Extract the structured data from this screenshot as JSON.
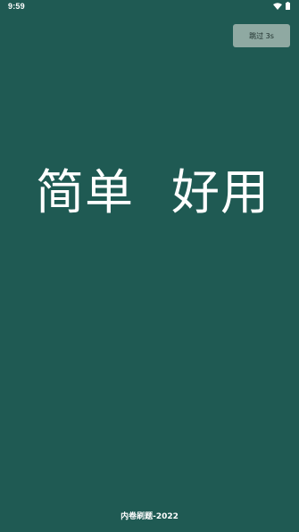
{
  "status_bar": {
    "time": "9:59",
    "wifi_icon": "wifi-icon",
    "battery_icon": "battery-icon"
  },
  "skip_button": {
    "label": "跳过 3s"
  },
  "slogan": {
    "left": "简单",
    "right": "好用"
  },
  "footer": {
    "text": "内卷刷题-2022"
  },
  "colors": {
    "background": "#1f5a53",
    "skip_button_bg": "#8fa9a2",
    "text": "#ffffff"
  }
}
